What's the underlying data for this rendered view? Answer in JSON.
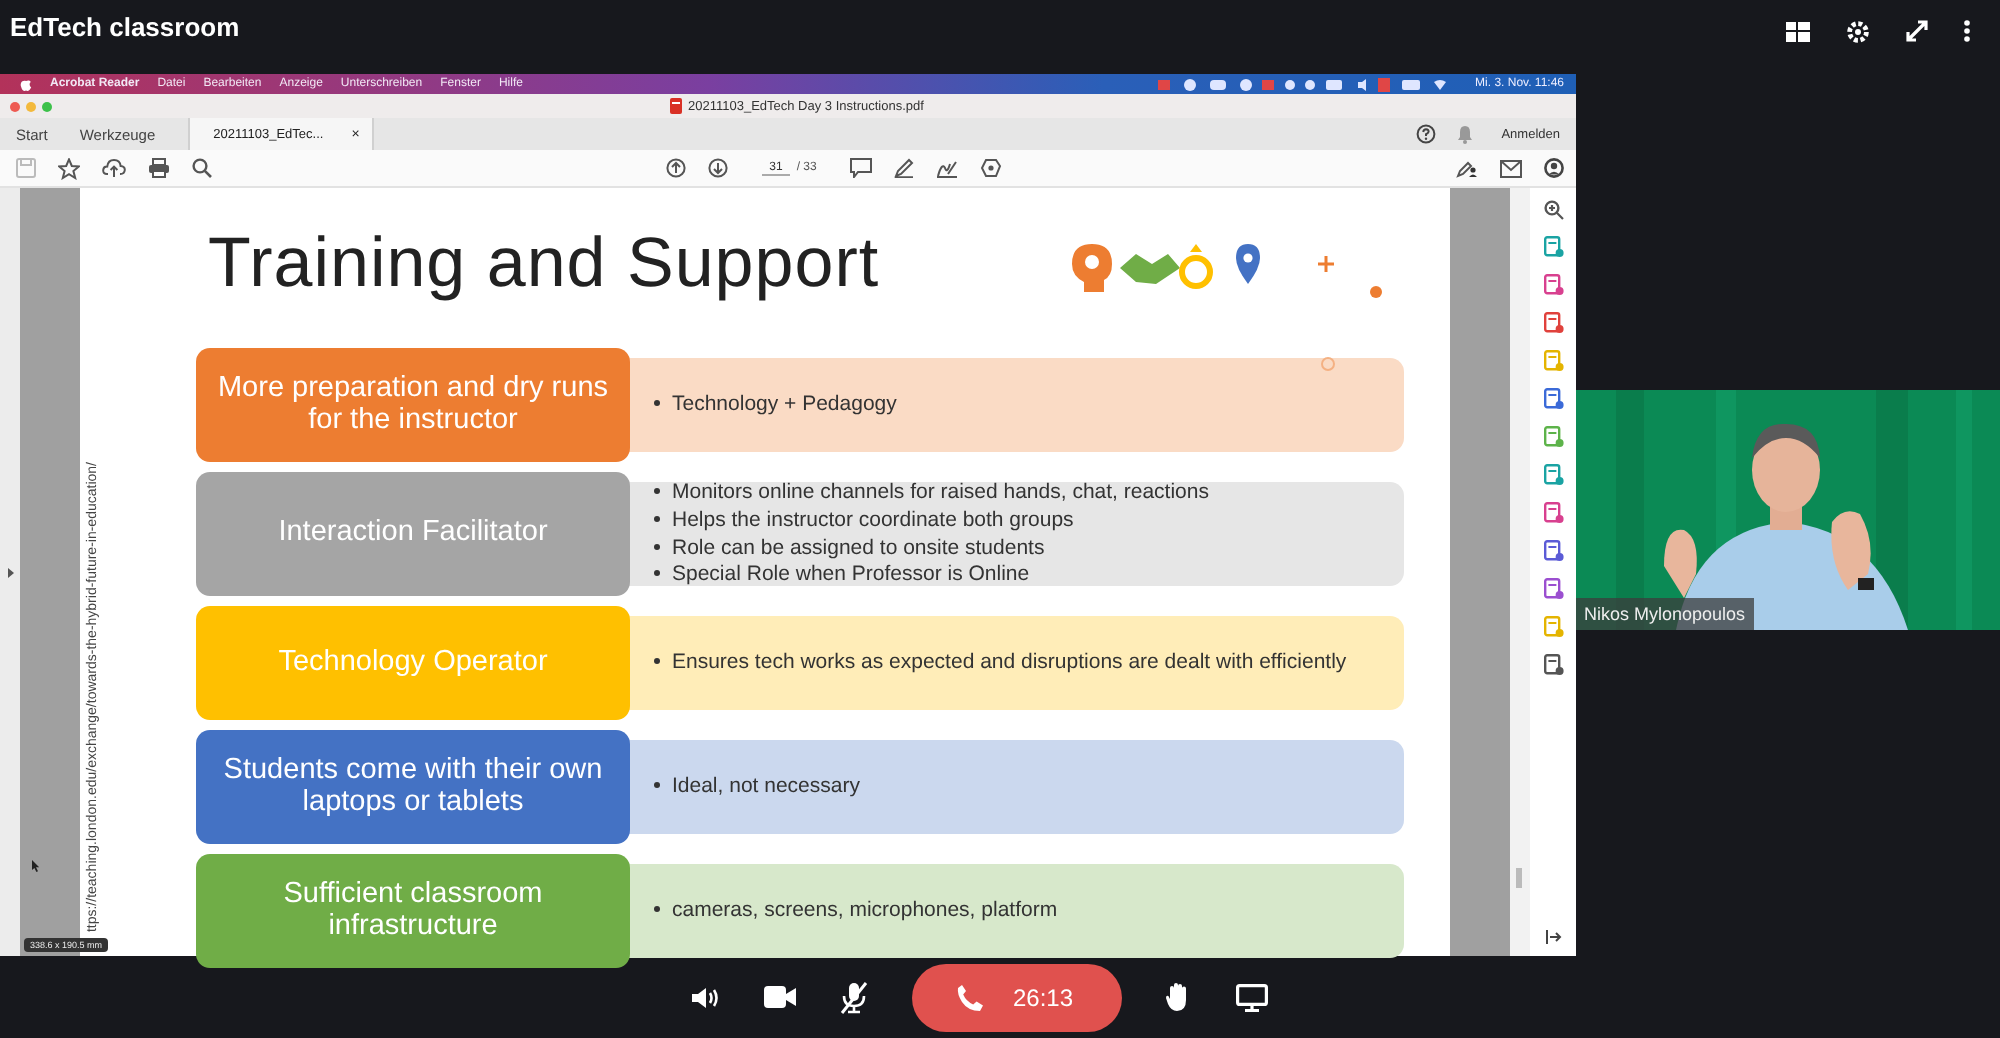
{
  "app": {
    "title": "EdTech classroom"
  },
  "menubar": {
    "items": [
      "Acrobat Reader",
      "Datei",
      "Bearbeiten",
      "Anzeige",
      "Unterschreiben",
      "Fenster",
      "Hilfe"
    ],
    "clock": "Mi. 3. Nov. 11:46"
  },
  "document": {
    "title": "20211103_EdTech Day 3 Instructions.pdf",
    "tabs": [
      {
        "label": "Start",
        "selected": false
      },
      {
        "label": "Werkzeuge",
        "selected": false
      },
      {
        "label": "20211103_EdTec...",
        "selected": true,
        "close": "×"
      }
    ],
    "page": "31",
    "page_total": "/ 33",
    "sign_in": "Anmelden",
    "size_label": "338.6 x 190.5 mm",
    "side_url": "ttps://teaching.london.edu/exchange/towards-the-hybrid-future-in-education/"
  },
  "slide": {
    "title": "Training and Support",
    "rows": [
      {
        "label": "More preparation and dry runs for the instructor",
        "color": "#ed7d31",
        "bullets": [
          "Technology + Pedagogy"
        ]
      },
      {
        "label": "Interaction Facilitator",
        "color": "#a5a5a5",
        "bullets": [
          "Monitors online channels for raised hands, chat, reactions",
          "Helps the instructor coordinate both groups",
          "Role can be assigned to onsite students",
          "Special Role when Professor is Online"
        ]
      },
      {
        "label": "Technology Operator",
        "color": "#ffc000",
        "bullets": [
          "Ensures tech works as expected and disruptions are dealt with efficiently"
        ]
      },
      {
        "label": "Students come with their own laptops or tablets",
        "color": "#4472c4",
        "bullets": [
          "Ideal, not necessary"
        ]
      },
      {
        "label": "Sufficient classroom infrastructure",
        "color": "#70ad47",
        "bullets": [
          "cameras, screens, microphones, platform"
        ]
      }
    ]
  },
  "video": {
    "name": "Nikos Mylonopoulos"
  },
  "call": {
    "timer": "26:13",
    "mic_muted": true
  }
}
